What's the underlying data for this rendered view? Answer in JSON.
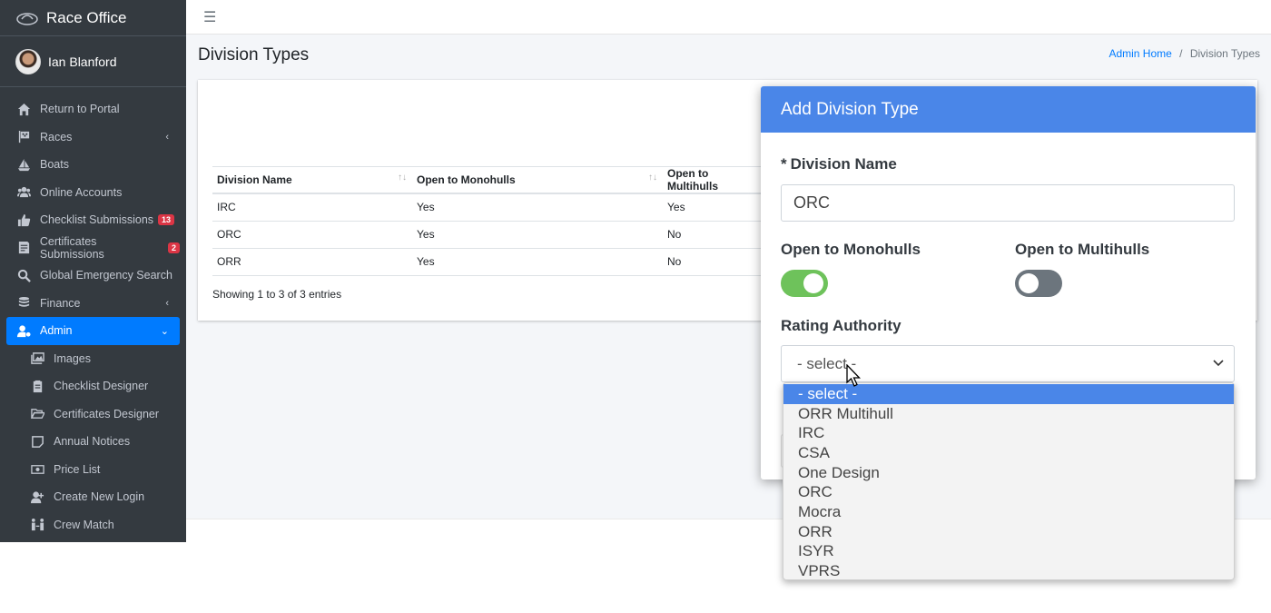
{
  "sidebar": {
    "brand": "Race Office",
    "user": "Ian Blanford",
    "items": [
      {
        "label": "Return to Portal",
        "icon": "home-icon"
      },
      {
        "label": "Races",
        "icon": "flag-checkered-icon"
      },
      {
        "label": "Boats",
        "icon": "sailboat-icon"
      },
      {
        "label": "Online Accounts",
        "icon": "users-icon"
      },
      {
        "label": "Checklist Submissions",
        "icon": "thumbs-up-icon",
        "badge": "13"
      },
      {
        "label": "Certificates Submissions",
        "icon": "certificate-icon",
        "badge": "2"
      },
      {
        "label": "Global Emergency Search",
        "icon": "search-icon"
      },
      {
        "label": "Finance",
        "icon": "coins-icon"
      },
      {
        "label": "Admin",
        "icon": "user-cog-icon"
      },
      {
        "label": "Images",
        "icon": "images-icon"
      },
      {
        "label": "Checklist Designer",
        "icon": "clipboard-icon"
      },
      {
        "label": "Certificates Designer",
        "icon": "folder-open-icon"
      },
      {
        "label": "Annual Notices",
        "icon": "sticky-note-icon"
      },
      {
        "label": "Price List",
        "icon": "money-bill-icon"
      },
      {
        "label": "Create New Login",
        "icon": "user-plus-icon"
      },
      {
        "label": "Crew Match",
        "icon": "people-arrows-icon"
      }
    ]
  },
  "header": {
    "menu_icon": "hamburger-icon"
  },
  "page": {
    "title": "Division Types",
    "breadcrumb": {
      "home": "Admin Home",
      "separator": "/",
      "current": "Division Types"
    }
  },
  "table": {
    "headers": [
      "Division Name",
      "Open to Monohulls",
      "Open to Multihulls"
    ],
    "rows": [
      [
        "IRC",
        "Yes",
        "Yes"
      ],
      [
        "ORC",
        "Yes",
        "No"
      ],
      [
        "ORR",
        "Yes",
        "No"
      ]
    ],
    "footer": "Showing 1 to 3 of 3 entries"
  },
  "modal": {
    "title": "Add Division Type",
    "name_required_mark": "*",
    "name_label": "Division Name",
    "name_value": "ORC",
    "mono_label": "Open to Monohulls",
    "multi_label": "Open to Multihulls",
    "mono_on": true,
    "multi_on": false,
    "rating_label": "Rating Authority",
    "select_value": "- select -",
    "options": [
      "- select -",
      "ORR Multihull",
      "IRC",
      "CSA",
      "One Design",
      "ORC",
      "Mocra",
      "ORR",
      "ISYR",
      "VPRS"
    ]
  },
  "colors": {
    "sidebar": "#343a40",
    "accent": "#007bff",
    "modal_header": "#4a86e8",
    "toggle_on": "#6ec25b"
  }
}
